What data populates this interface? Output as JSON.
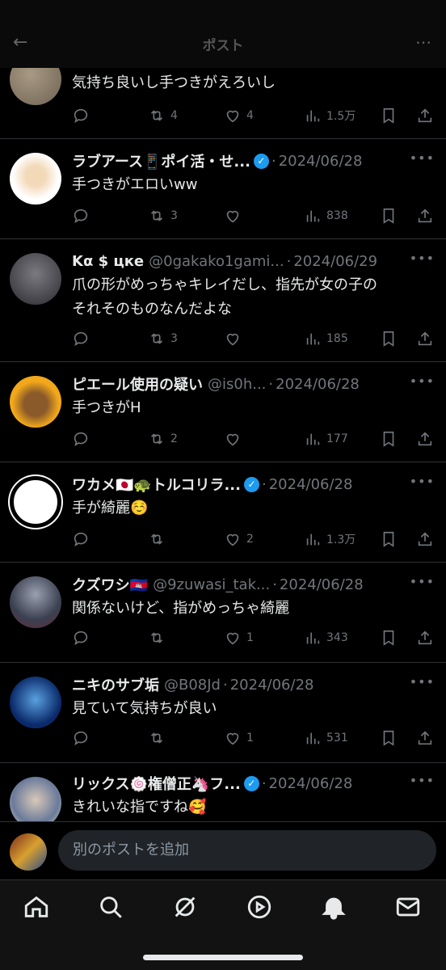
{
  "header": {
    "title": "ポスト",
    "back_icon": "back-arrow-icon",
    "more_icon": "more-icon"
  },
  "posts": [
    {
      "name": "",
      "handle": "",
      "date": "",
      "text": "気持ち良いし手つきがえろいし",
      "reply": "",
      "retweets": "4",
      "likes": "4",
      "views": "1.5万",
      "verified": false
    },
    {
      "name": "ラブアース📱ポイ活・せ...",
      "handle": "",
      "date": "2024/06/28",
      "text": "手つきがエロいww",
      "reply": "",
      "retweets": "3",
      "likes": "",
      "views": "838",
      "verified": true
    },
    {
      "name": "Kα $ цкe",
      "handle": "@0gakako1gami...",
      "date": "2024/06/29",
      "text": "爪の形がめっちゃキレイだし、指先が女の子の\nそれそのものなんだよな",
      "reply": "",
      "retweets": "3",
      "likes": "",
      "views": "185",
      "verified": false
    },
    {
      "name": "ピエール使用の疑い",
      "handle": "@is0h...",
      "date": "2024/06/28",
      "text": "手つきがH",
      "reply": "",
      "retweets": "2",
      "likes": "",
      "views": "177",
      "verified": false
    },
    {
      "name": "ワカメ🇯🇵🐢トルコリラ...",
      "handle": "",
      "date": "2024/06/28",
      "text": "手が綺麗☺️",
      "reply": "",
      "retweets": "",
      "likes": "2",
      "views": "1.3万",
      "verified": true
    },
    {
      "name": "クズワシ🇰🇭",
      "handle": "@9zuwasi_tak...",
      "date": "2024/06/28",
      "text": "関係ないけど、指がめっちゃ綺麗",
      "reply": "",
      "retweets": "",
      "likes": "1",
      "views": "343",
      "verified": false
    },
    {
      "name": "ニキのサブ垢",
      "handle": "@B08Jd",
      "date": "2024/06/28",
      "text": "見ていて気持ちが良い",
      "reply": "",
      "retweets": "",
      "likes": "1",
      "views": "531",
      "verified": false
    },
    {
      "name": "リックス🍥権僧正🦄フ...",
      "handle": "",
      "date": "2024/06/28",
      "text": "きれいな指ですね🥰",
      "reply": "",
      "retweets": "",
      "likes": "",
      "views": "",
      "verified": true
    }
  ],
  "composer": {
    "placeholder": "別のポストを追加"
  },
  "tabbar": {
    "items": [
      "home-icon",
      "search-icon",
      "grok-icon",
      "video-icon",
      "notifications-icon",
      "messages-icon"
    ]
  },
  "colors": {
    "background": "#000000",
    "text": "#e7e9ea",
    "muted": "#71767b",
    "verified": "#1d9bf0",
    "divider": "#2f3336"
  }
}
